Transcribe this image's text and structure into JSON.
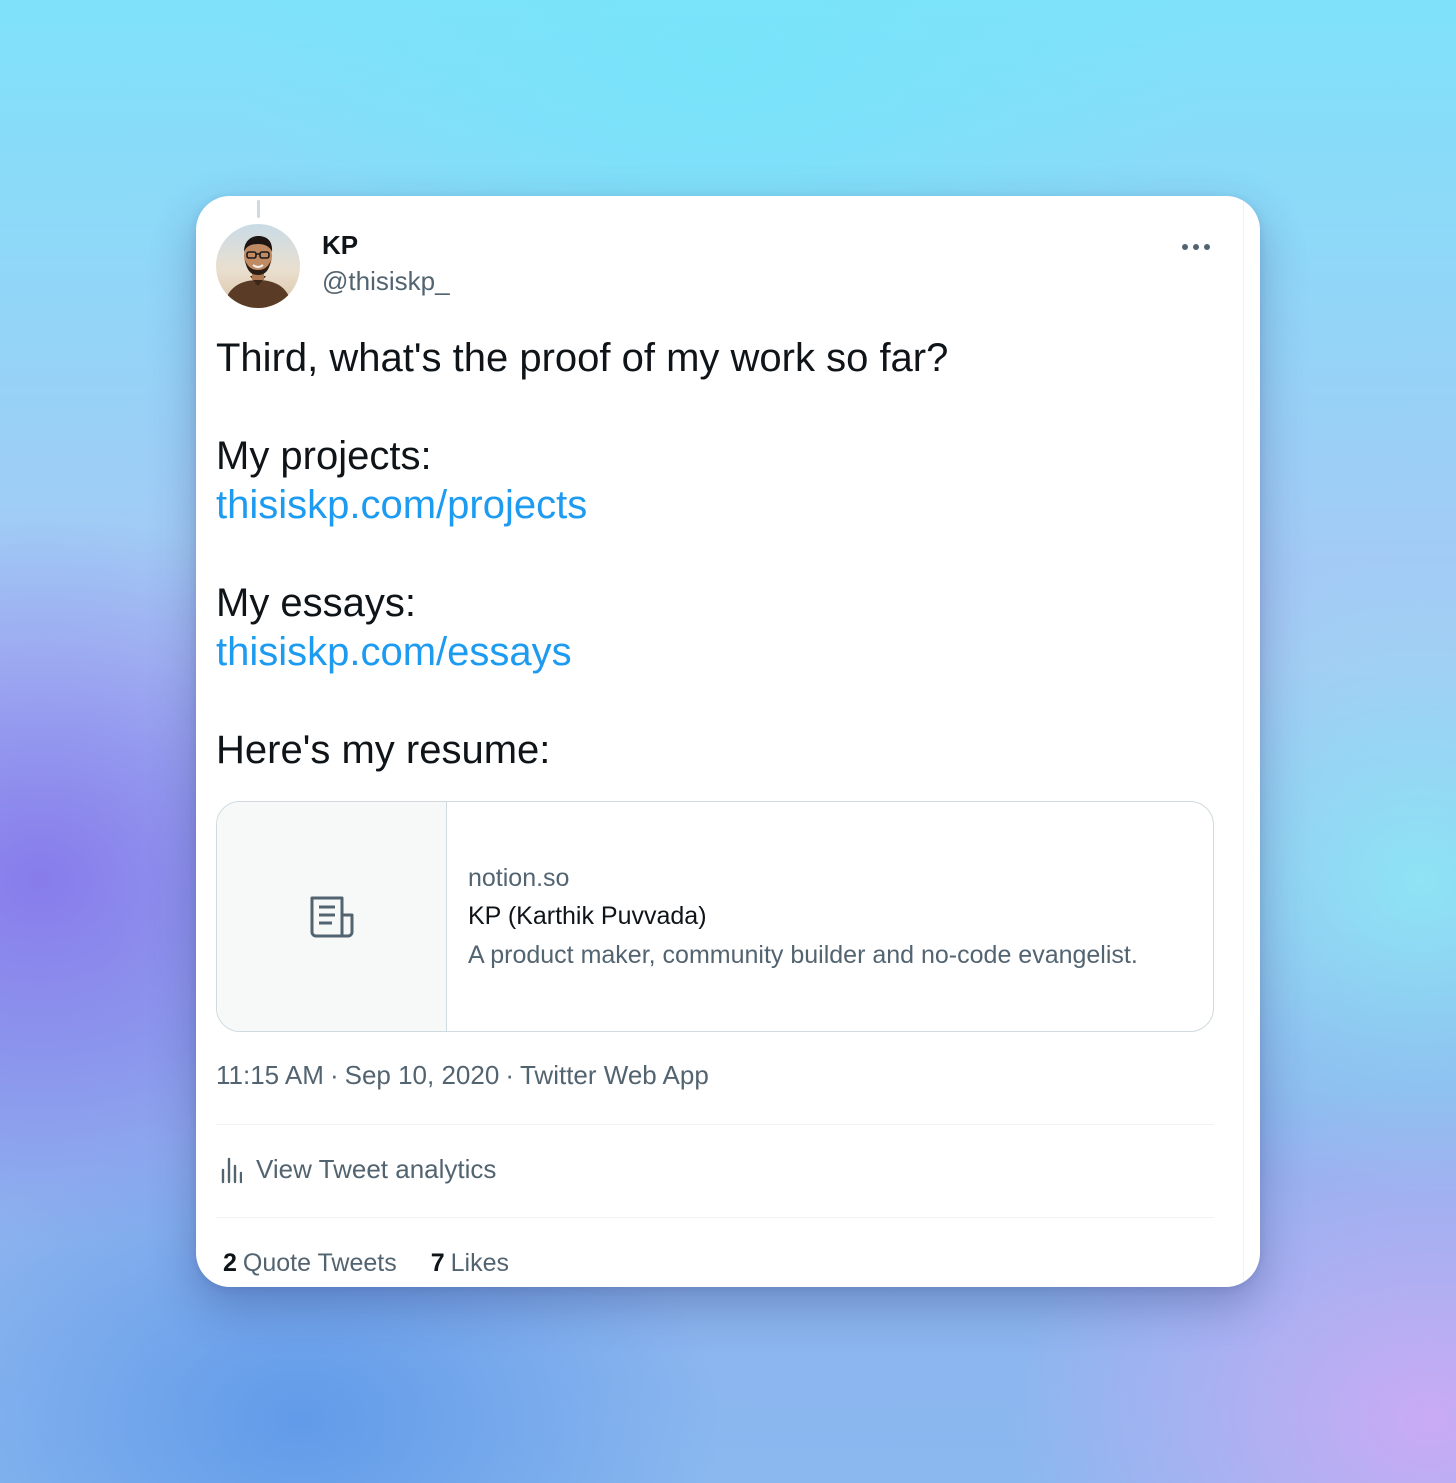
{
  "tweet": {
    "author": {
      "name": "KP",
      "handle": "@thisiskp_"
    },
    "text": {
      "line1": "Third, what's the proof of my work so far?",
      "projects_label": "My projects:",
      "projects_link": "thisiskp.com/projects",
      "essays_label": "My essays:",
      "essays_link": "thisiskp.com/essays",
      "resume_label": "Here's my resume:"
    },
    "link_card": {
      "thumb_icon": "document-icon",
      "domain": "notion.so",
      "title": "KP (Karthik Puvvada)",
      "description": "A product maker, community builder and no-code evangelist."
    },
    "meta": {
      "time": "11:15 AM",
      "separator": "·",
      "date": "Sep 10, 2020",
      "source": "Twitter Web App"
    },
    "analytics": {
      "icon": "bar-chart-icon",
      "label": "View Tweet analytics"
    },
    "stats": {
      "quote_tweets_count": "2",
      "quote_tweets_label": "Quote Tweets",
      "likes_count": "7",
      "likes_label": "Likes"
    }
  },
  "colors": {
    "link": "#1d9bf0",
    "text_primary": "#0f1419",
    "text_secondary": "#536471",
    "border": "#cfd9de"
  }
}
